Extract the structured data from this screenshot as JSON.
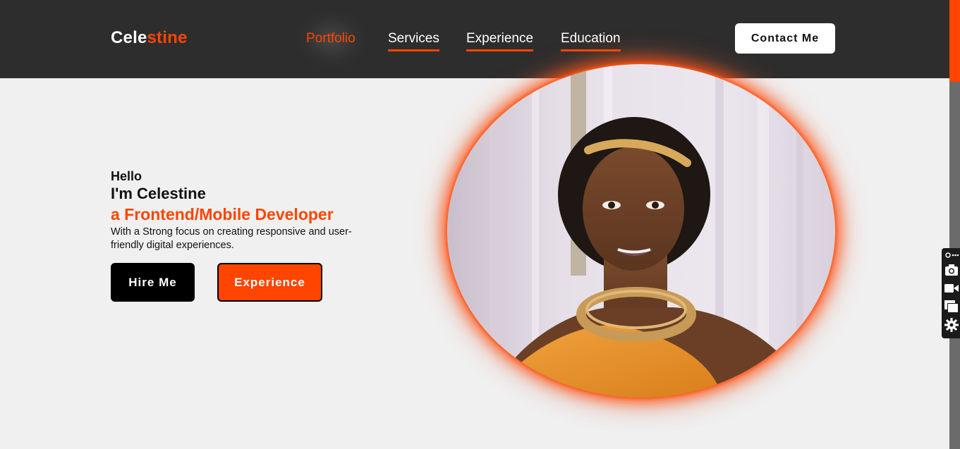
{
  "brand": {
    "logo_first": "Cele",
    "logo_second": "stine"
  },
  "nav": {
    "items": [
      {
        "label": "Portfolio",
        "active": true
      },
      {
        "label": "Services",
        "active": false
      },
      {
        "label": "Experience",
        "active": false
      },
      {
        "label": "Education",
        "active": false
      }
    ],
    "contact_label": "Contact Me"
  },
  "hero": {
    "greeting": "Hello",
    "name_line": "I'm Celestine",
    "role_line": "a Frontend/Mobile Developer",
    "description": "With a Strong focus on creating responsive and user-friendly digital experiences.",
    "hire_label": "Hire Me",
    "experience_label": "Experience"
  },
  "toolbar": {
    "icons": [
      "link-more-icon",
      "camera-icon",
      "video-camera-icon",
      "windows-icon",
      "gear-icon"
    ]
  },
  "colors": {
    "accent": "#ff4500",
    "header_bg": "#2d2d2d",
    "page_bg": "#f0f0f0",
    "text_dark": "#111111"
  }
}
